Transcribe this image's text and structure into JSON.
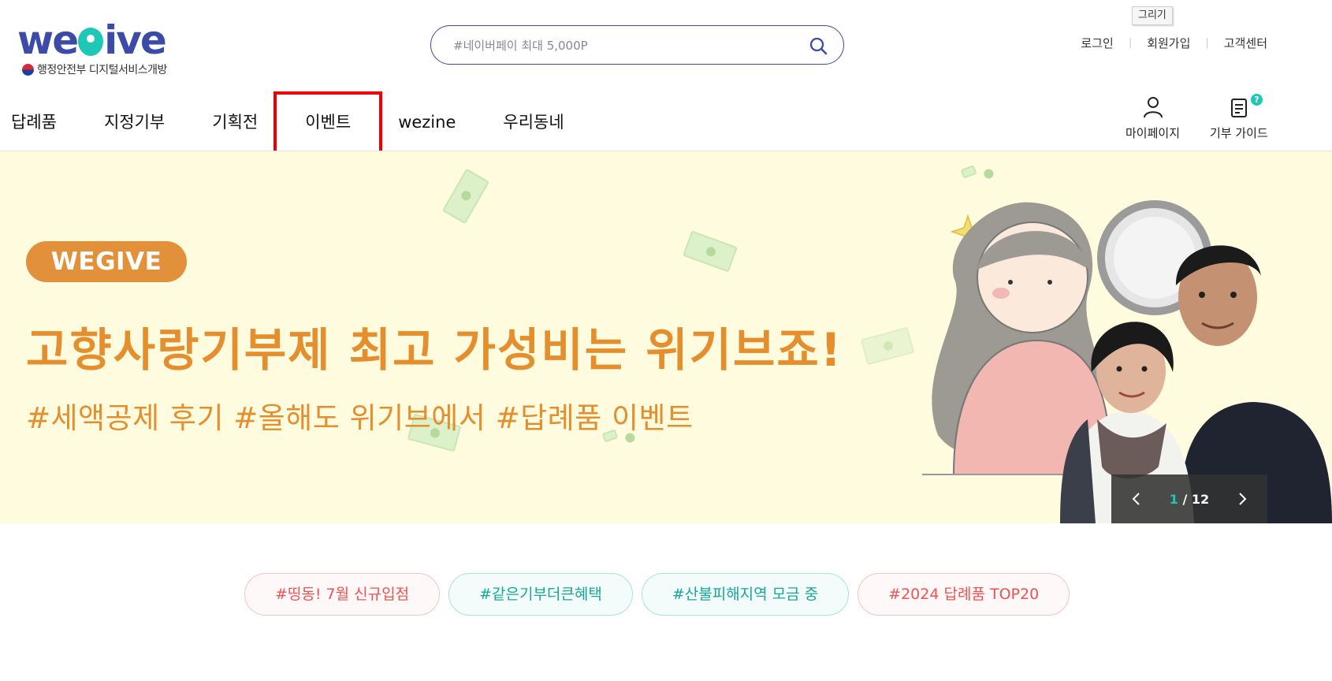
{
  "logo": {
    "wordmark_left": "we",
    "wordmark_right": "ive",
    "subtitle": "행정안전부 디지털서비스개방"
  },
  "search": {
    "placeholder": "#네이버페이 최대 5,000P"
  },
  "tooltip": "그리기",
  "util_links": [
    {
      "label": "로그인"
    },
    {
      "label": "회원가입"
    },
    {
      "label": "고객센터"
    }
  ],
  "gnb": [
    {
      "label": "답례품"
    },
    {
      "label": "지정기부"
    },
    {
      "label": "기획전"
    },
    {
      "label": "이벤트"
    },
    {
      "label": "wezine"
    },
    {
      "label": "우리동네"
    }
  ],
  "quick_menu": [
    {
      "label": "마이페이지",
      "icon": "user-icon"
    },
    {
      "label": "기부 가이드",
      "icon": "guide-icon",
      "badge": "?"
    }
  ],
  "banner": {
    "badge": "WEGIVE",
    "title": "고향사랑기부제 최고 가성비는 위기브죠!",
    "subtitle": "#세액공제 후기 #올해도 위기브에서 #답례품 이벤트",
    "pager": {
      "current": "1",
      "separator": " / ",
      "total": "12"
    }
  },
  "tags": [
    {
      "label": "#띵동! 7월 신규입점",
      "color": "red"
    },
    {
      "label": "#같은기부더큰혜택",
      "color": "teal"
    },
    {
      "label": "#산불피해지역 모금 중",
      "color": "teal"
    },
    {
      "label": "#2024 답례품 TOP20",
      "color": "red"
    }
  ],
  "colors": {
    "brand": "#3c4ba8",
    "accent": "#1ec7b6",
    "banner_text": "#e58e2e",
    "banner_bg": "#fffbdf"
  }
}
